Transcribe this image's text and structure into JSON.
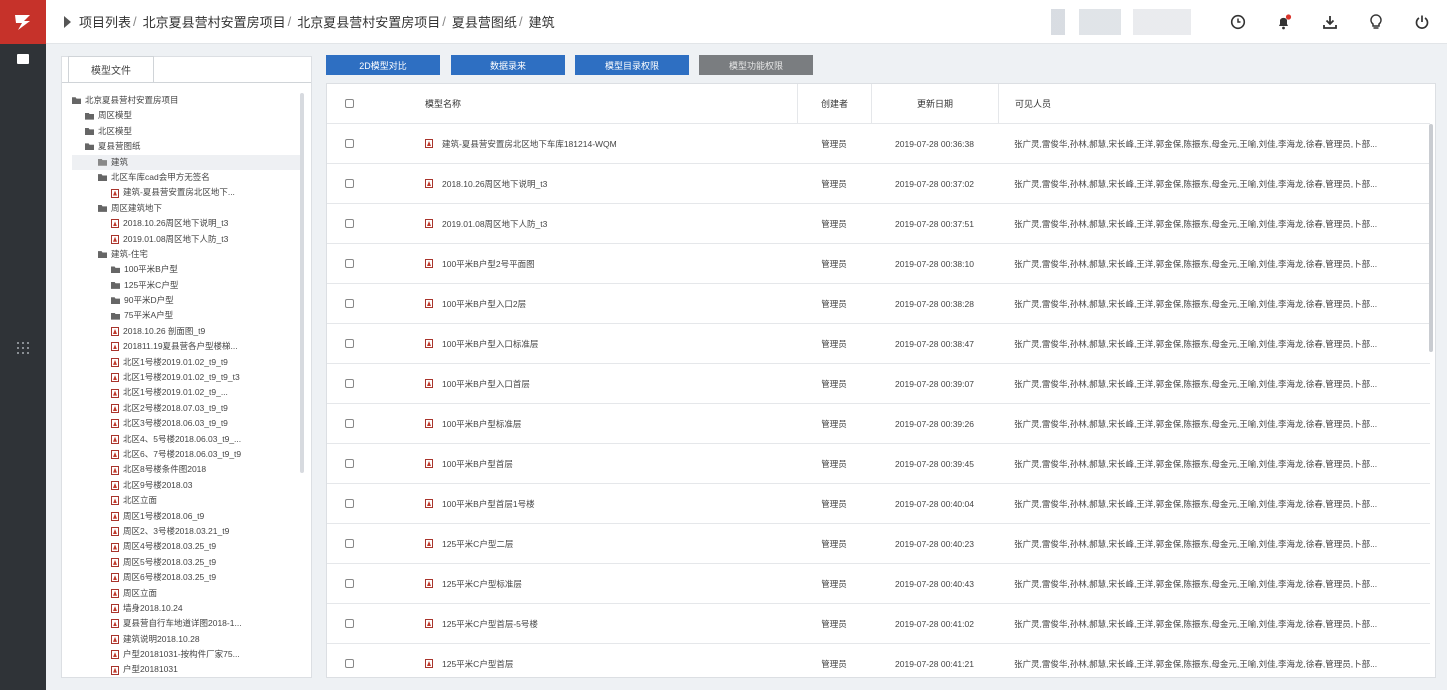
{
  "breadcrumb": {
    "items": [
      "项目列表",
      "北京夏县营村安置房项目",
      "北京夏县营村安置房项目",
      "夏县营图纸",
      "建筑"
    ]
  },
  "colors": {
    "accent": "#2e6fc2",
    "brand": "#c6322a",
    "rail": "#2f3337"
  },
  "topbar": {
    "icons": [
      "clock-icon",
      "notification-bell-icon",
      "download-icon",
      "lightbulb-icon",
      "power-icon"
    ]
  },
  "tree_panel": {
    "tab_label": "模型文件",
    "nodes": [
      {
        "label": "北京夏县营村安置房项目",
        "type": "folder"
      },
      {
        "label": "周区模型",
        "type": "folder"
      },
      {
        "label": "北区模型",
        "type": "folder"
      },
      {
        "label": "夏县营图纸",
        "type": "folder"
      },
      {
        "label": "建筑",
        "type": "folder-open"
      },
      {
        "label": "北区车库cad会甲方无签名",
        "type": "folder"
      },
      {
        "label": "建筑-夏县营安置房北区地下...",
        "type": "pdf"
      },
      {
        "label": "周区建筑地下",
        "type": "folder"
      },
      {
        "label": "2018.10.26周区地下说明_t3",
        "type": "pdf"
      },
      {
        "label": "2019.01.08周区地下人防_t3",
        "type": "pdf"
      },
      {
        "label": "建筑-住宅",
        "type": "folder"
      },
      {
        "label": "100平米B户型",
        "type": "folder"
      },
      {
        "label": "125平米C户型",
        "type": "folder"
      },
      {
        "label": "90平米D户型",
        "type": "folder"
      },
      {
        "label": "75平米A户型",
        "type": "folder"
      },
      {
        "label": "2018.10.26 剖面图_t9",
        "type": "pdf"
      },
      {
        "label": "201811.19夏县营各户型楼梯...",
        "type": "pdf"
      },
      {
        "label": "北区1号楼2019.01.02_t9_t9",
        "type": "pdf"
      },
      {
        "label": "北区1号楼2019.01.02_t9_t9_t3",
        "type": "pdf"
      },
      {
        "label": "北区1号楼2019.01.02_t9_...",
        "type": "pdf"
      },
      {
        "label": "北区2号楼2018.07.03_t9_t9",
        "type": "pdf"
      },
      {
        "label": "北区3号楼2018.06.03_t9_t9",
        "type": "pdf"
      },
      {
        "label": "北区4、5号楼2018.06.03_t9_...",
        "type": "pdf"
      },
      {
        "label": "北区6、7号楼2018.06.03_t9_t9",
        "type": "pdf"
      },
      {
        "label": "北区8号楼条件图2018",
        "type": "pdf"
      },
      {
        "label": "北区9号楼2018.03",
        "type": "pdf"
      },
      {
        "label": "北区立面",
        "type": "pdf"
      },
      {
        "label": "周区1号楼2018.06_t9",
        "type": "pdf"
      },
      {
        "label": "周区2、3号楼2018.03.21_t9",
        "type": "pdf"
      },
      {
        "label": "周区4号楼2018.03.25_t9",
        "type": "pdf"
      },
      {
        "label": "周区5号楼2018.03.25_t9",
        "type": "pdf"
      },
      {
        "label": "周区6号楼2018.03.25_t9",
        "type": "pdf"
      },
      {
        "label": "周区立面",
        "type": "pdf"
      },
      {
        "label": "墙身2018.10.24",
        "type": "pdf"
      },
      {
        "label": "夏县营自行车地道详图2018-1...",
        "type": "pdf"
      },
      {
        "label": "建筑说明2018.10.28",
        "type": "pdf"
      },
      {
        "label": "户型20181031-按构件厂家75...",
        "type": "pdf"
      },
      {
        "label": "户型20181031",
        "type": "pdf"
      }
    ]
  },
  "toolbar": {
    "buttons": [
      "2D模型对比",
      "数据录来",
      "模型目录权限",
      "模型功能权限"
    ]
  },
  "table": {
    "headers": [
      "模型名称",
      "创建者",
      "更新日期",
      "可见人员"
    ],
    "rows": [
      {
        "name": "建筑-夏县营安置房北区地下车库181214-WQM",
        "creator": "管理员",
        "date": "2019-07-28 00:36:38",
        "users": "张广灵,雷俊华,孙林,郝慧,宋长峰,王洋,郭金保,陈振东,母金元,王喻,刘佳,李海龙,徐春,管理员,卜部..."
      },
      {
        "name": "2018.10.26周区地下说明_t3",
        "creator": "管理员",
        "date": "2019-07-28 00:37:02",
        "users": "张广灵,雷俊华,孙林,郝慧,宋长峰,王洋,郭金保,陈振东,母金元,王喻,刘佳,李海龙,徐春,管理员,卜部..."
      },
      {
        "name": "2019.01.08周区地下人防_t3",
        "creator": "管理员",
        "date": "2019-07-28 00:37:51",
        "users": "张广灵,雷俊华,孙林,郝慧,宋长峰,王洋,郭金保,陈振东,母金元,王喻,刘佳,李海龙,徐春,管理员,卜部..."
      },
      {
        "name": "100平米B户型2号平面图",
        "creator": "管理员",
        "date": "2019-07-28 00:38:10",
        "users": "张广灵,雷俊华,孙林,郝慧,宋长峰,王洋,郭金保,陈振东,母金元,王喻,刘佳,李海龙,徐春,管理员,卜部..."
      },
      {
        "name": "100平米B户型入口2层",
        "creator": "管理员",
        "date": "2019-07-28 00:38:28",
        "users": "张广灵,雷俊华,孙林,郝慧,宋长峰,王洋,郭金保,陈振东,母金元,王喻,刘佳,李海龙,徐春,管理员,卜部..."
      },
      {
        "name": "100平米B户型入口标准层",
        "creator": "管理员",
        "date": "2019-07-28 00:38:47",
        "users": "张广灵,雷俊华,孙林,郝慧,宋长峰,王洋,郭金保,陈振东,母金元,王喻,刘佳,李海龙,徐春,管理员,卜部..."
      },
      {
        "name": "100平米B户型入口首层",
        "creator": "管理员",
        "date": "2019-07-28 00:39:07",
        "users": "张广灵,雷俊华,孙林,郝慧,宋长峰,王洋,郭金保,陈振东,母金元,王喻,刘佳,李海龙,徐春,管理员,卜部..."
      },
      {
        "name": "100平米B户型标准层",
        "creator": "管理员",
        "date": "2019-07-28 00:39:26",
        "users": "张广灵,雷俊华,孙林,郝慧,宋长峰,王洋,郭金保,陈振东,母金元,王喻,刘佳,李海龙,徐春,管理员,卜部..."
      },
      {
        "name": "100平米B户型首层",
        "creator": "管理员",
        "date": "2019-07-28 00:39:45",
        "users": "张广灵,雷俊华,孙林,郝慧,宋长峰,王洋,郭金保,陈振东,母金元,王喻,刘佳,李海龙,徐春,管理员,卜部..."
      },
      {
        "name": "100平米B户型首层1号楼",
        "creator": "管理员",
        "date": "2019-07-28 00:40:04",
        "users": "张广灵,雷俊华,孙林,郝慧,宋长峰,王洋,郭金保,陈振东,母金元,王喻,刘佳,李海龙,徐春,管理员,卜部..."
      },
      {
        "name": "125平米C户型二层",
        "creator": "管理员",
        "date": "2019-07-28 00:40:23",
        "users": "张广灵,雷俊华,孙林,郝慧,宋长峰,王洋,郭金保,陈振东,母金元,王喻,刘佳,李海龙,徐春,管理员,卜部..."
      },
      {
        "name": "125平米C户型标准层",
        "creator": "管理员",
        "date": "2019-07-28 00:40:43",
        "users": "张广灵,雷俊华,孙林,郝慧,宋长峰,王洋,郭金保,陈振东,母金元,王喻,刘佳,李海龙,徐春,管理员,卜部..."
      },
      {
        "name": "125平米C户型首层-5号楼",
        "creator": "管理员",
        "date": "2019-07-28 00:41:02",
        "users": "张广灵,雷俊华,孙林,郝慧,宋长峰,王洋,郭金保,陈振东,母金元,王喻,刘佳,李海龙,徐春,管理员,卜部..."
      },
      {
        "name": "125平米C户型首层",
        "creator": "管理员",
        "date": "2019-07-28 00:41:21",
        "users": "张广灵,雷俊华,孙林,郝慧,宋长峰,王洋,郭金保,陈振东,母金元,王喻,刘佳,李海龙,徐春,管理员,卜部..."
      }
    ]
  }
}
